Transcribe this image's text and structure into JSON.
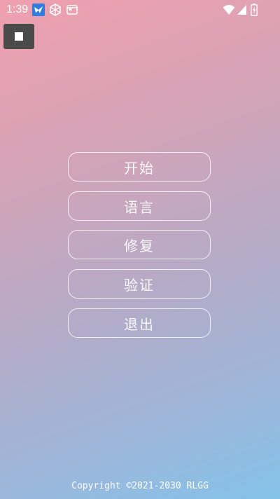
{
  "status_bar": {
    "time": "1:39",
    "left_icons": [
      "app-notification-icon",
      "shield-app-icon",
      "window-app-icon"
    ],
    "right_icons": [
      "wifi-icon",
      "cell-signal-icon",
      "battery-charging-icon"
    ]
  },
  "stop_button": {
    "icon": "stop-icon"
  },
  "menu": {
    "items": [
      {
        "label": "开始"
      },
      {
        "label": "语言"
      },
      {
        "label": "修复"
      },
      {
        "label": "验证"
      },
      {
        "label": "退出"
      }
    ]
  },
  "footer": {
    "copyright": "Copyright ©2021-2030 RLGG"
  },
  "colors": {
    "gradient_top": "#f0a0ae",
    "gradient_bottom": "#84c2e9",
    "stop_button_bg": "#4a4a4a"
  }
}
